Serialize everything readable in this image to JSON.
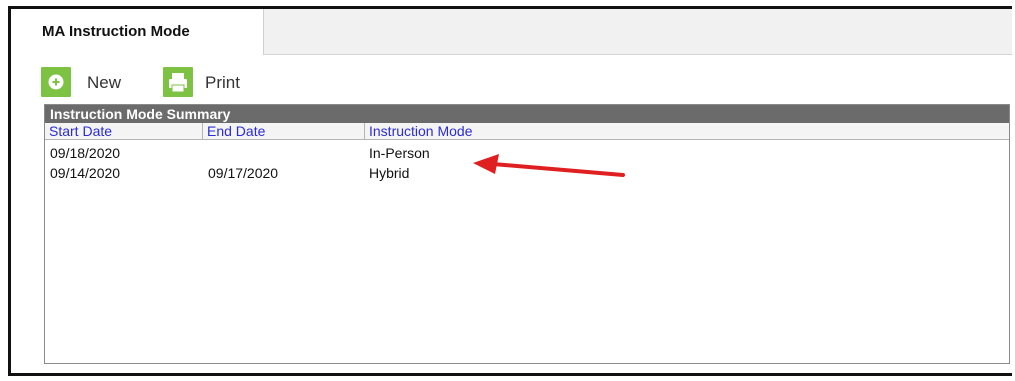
{
  "tab": {
    "label": "MA Instruction Mode"
  },
  "toolbar": {
    "new_label": "New",
    "print_label": "Print",
    "new_icon": "plus-circle-icon",
    "print_icon": "printer-icon"
  },
  "summary": {
    "title": "Instruction Mode Summary",
    "columns": [
      "Start Date",
      "End Date",
      "Instruction Mode"
    ],
    "rows": [
      {
        "start_date": "09/18/2020",
        "end_date": "",
        "mode": "In-Person"
      },
      {
        "start_date": "09/14/2020",
        "end_date": "09/17/2020",
        "mode": "Hybrid"
      }
    ]
  },
  "colors": {
    "accent_green": "#7dc242",
    "header_gray": "#6b6b6b",
    "link_blue": "#2c2cd6",
    "arrow_red": "#e02020"
  }
}
